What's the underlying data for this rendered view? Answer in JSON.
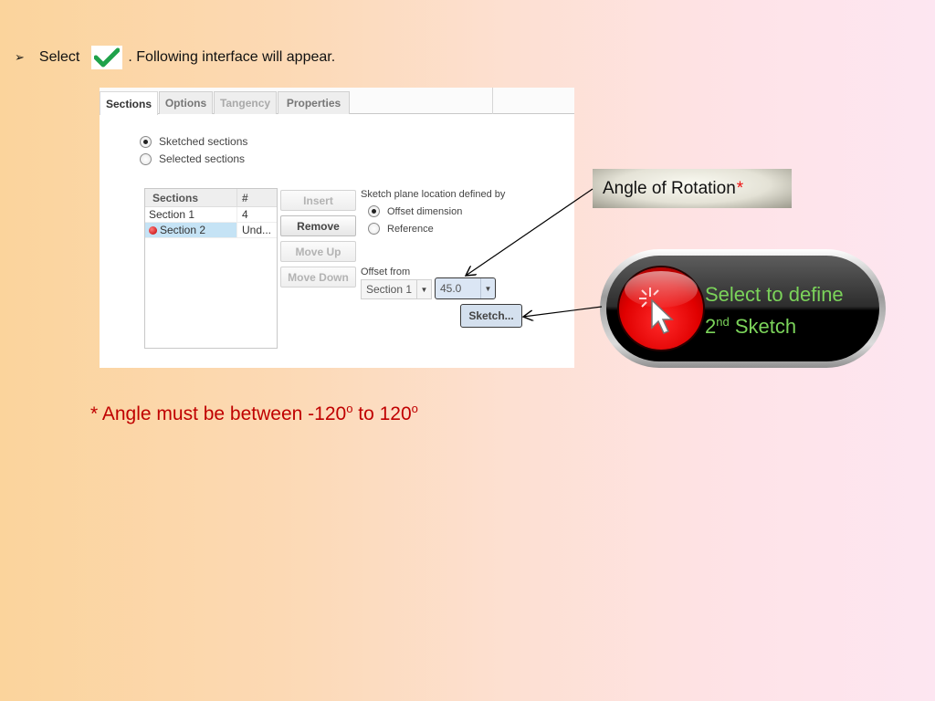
{
  "instruction": {
    "bullet_icon": "arrowhead-bullet",
    "prefix": "Select",
    "icon": "green-check-icon",
    "suffix": ". Following interface will appear."
  },
  "dialog": {
    "tabs": [
      {
        "label": "Sections",
        "state": "active"
      },
      {
        "label": "Options",
        "state": "enabled"
      },
      {
        "label": "Tangency",
        "state": "disabled"
      },
      {
        "label": "Properties",
        "state": "enabled"
      }
    ],
    "section_type": {
      "options": [
        {
          "label": "Sketched sections",
          "checked": true
        },
        {
          "label": "Selected sections",
          "checked": false
        }
      ]
    },
    "sections_table": {
      "headers": [
        "Sections",
        "#"
      ],
      "rows": [
        {
          "name": "Section 1",
          "value": "4",
          "selected": false,
          "error": false
        },
        {
          "name": "Section 2",
          "value": "Und...",
          "selected": true,
          "error": true
        }
      ]
    },
    "buttons": [
      {
        "label": "Insert",
        "enabled": false
      },
      {
        "label": "Remove",
        "enabled": true
      },
      {
        "label": "Move Up",
        "enabled": false
      },
      {
        "label": "Move Down",
        "enabled": false
      }
    ],
    "plane_location": {
      "label": "Sketch plane location defined by",
      "options": [
        {
          "label": "Offset dimension",
          "checked": true
        },
        {
          "label": "Reference",
          "checked": false
        }
      ]
    },
    "offset_from": {
      "label": "Offset from",
      "section_value": "Section 1",
      "angle_value": "45.0"
    },
    "sketch_button": "Sketch..."
  },
  "callouts": {
    "angle": {
      "text": "Angle of Rotation",
      "marker": "*"
    },
    "select_button": {
      "line1": "Select to define",
      "line2_prefix": "2",
      "line2_sup": "nd",
      "line2_suffix": " Sketch"
    }
  },
  "note": {
    "prefix": "* Angle must be between -120",
    "sup1": "o",
    "middle": " to 120",
    "sup2": "o"
  },
  "colors": {
    "note_red": "#c00000",
    "callout_green": "#7bd35a",
    "selection_blue": "#c5e3f5",
    "highlight_blue": "#dbe6f4"
  }
}
